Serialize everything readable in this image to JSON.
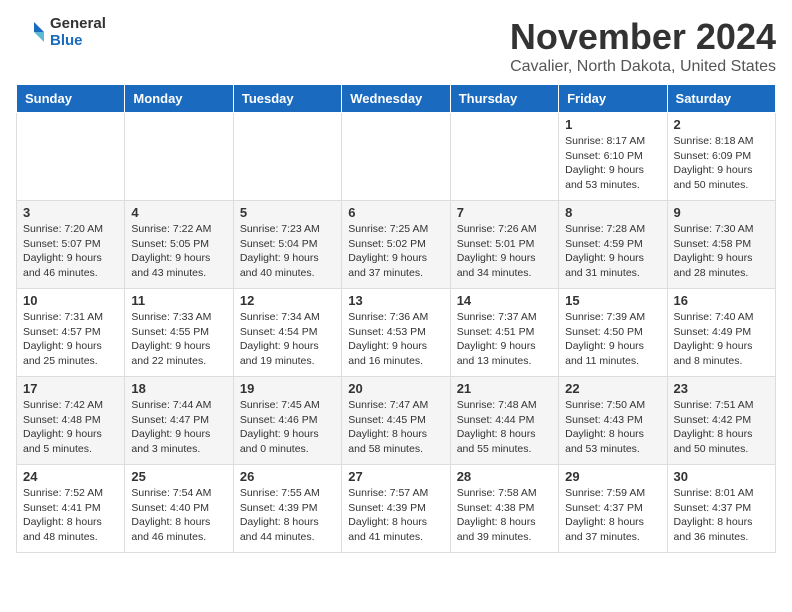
{
  "logo": {
    "general": "General",
    "blue": "Blue"
  },
  "header": {
    "month": "November 2024",
    "location": "Cavalier, North Dakota, United States"
  },
  "weekdays": [
    "Sunday",
    "Monday",
    "Tuesday",
    "Wednesday",
    "Thursday",
    "Friday",
    "Saturday"
  ],
  "weeks": [
    [
      {
        "day": "",
        "info": ""
      },
      {
        "day": "",
        "info": ""
      },
      {
        "day": "",
        "info": ""
      },
      {
        "day": "",
        "info": ""
      },
      {
        "day": "",
        "info": ""
      },
      {
        "day": "1",
        "info": "Sunrise: 8:17 AM\nSunset: 6:10 PM\nDaylight: 9 hours and 53 minutes."
      },
      {
        "day": "2",
        "info": "Sunrise: 8:18 AM\nSunset: 6:09 PM\nDaylight: 9 hours and 50 minutes."
      }
    ],
    [
      {
        "day": "3",
        "info": "Sunrise: 7:20 AM\nSunset: 5:07 PM\nDaylight: 9 hours and 46 minutes."
      },
      {
        "day": "4",
        "info": "Sunrise: 7:22 AM\nSunset: 5:05 PM\nDaylight: 9 hours and 43 minutes."
      },
      {
        "day": "5",
        "info": "Sunrise: 7:23 AM\nSunset: 5:04 PM\nDaylight: 9 hours and 40 minutes."
      },
      {
        "day": "6",
        "info": "Sunrise: 7:25 AM\nSunset: 5:02 PM\nDaylight: 9 hours and 37 minutes."
      },
      {
        "day": "7",
        "info": "Sunrise: 7:26 AM\nSunset: 5:01 PM\nDaylight: 9 hours and 34 minutes."
      },
      {
        "day": "8",
        "info": "Sunrise: 7:28 AM\nSunset: 4:59 PM\nDaylight: 9 hours and 31 minutes."
      },
      {
        "day": "9",
        "info": "Sunrise: 7:30 AM\nSunset: 4:58 PM\nDaylight: 9 hours and 28 minutes."
      }
    ],
    [
      {
        "day": "10",
        "info": "Sunrise: 7:31 AM\nSunset: 4:57 PM\nDaylight: 9 hours and 25 minutes."
      },
      {
        "day": "11",
        "info": "Sunrise: 7:33 AM\nSunset: 4:55 PM\nDaylight: 9 hours and 22 minutes."
      },
      {
        "day": "12",
        "info": "Sunrise: 7:34 AM\nSunset: 4:54 PM\nDaylight: 9 hours and 19 minutes."
      },
      {
        "day": "13",
        "info": "Sunrise: 7:36 AM\nSunset: 4:53 PM\nDaylight: 9 hours and 16 minutes."
      },
      {
        "day": "14",
        "info": "Sunrise: 7:37 AM\nSunset: 4:51 PM\nDaylight: 9 hours and 13 minutes."
      },
      {
        "day": "15",
        "info": "Sunrise: 7:39 AM\nSunset: 4:50 PM\nDaylight: 9 hours and 11 minutes."
      },
      {
        "day": "16",
        "info": "Sunrise: 7:40 AM\nSunset: 4:49 PM\nDaylight: 9 hours and 8 minutes."
      }
    ],
    [
      {
        "day": "17",
        "info": "Sunrise: 7:42 AM\nSunset: 4:48 PM\nDaylight: 9 hours and 5 minutes."
      },
      {
        "day": "18",
        "info": "Sunrise: 7:44 AM\nSunset: 4:47 PM\nDaylight: 9 hours and 3 minutes."
      },
      {
        "day": "19",
        "info": "Sunrise: 7:45 AM\nSunset: 4:46 PM\nDaylight: 9 hours and 0 minutes."
      },
      {
        "day": "20",
        "info": "Sunrise: 7:47 AM\nSunset: 4:45 PM\nDaylight: 8 hours and 58 minutes."
      },
      {
        "day": "21",
        "info": "Sunrise: 7:48 AM\nSunset: 4:44 PM\nDaylight: 8 hours and 55 minutes."
      },
      {
        "day": "22",
        "info": "Sunrise: 7:50 AM\nSunset: 4:43 PM\nDaylight: 8 hours and 53 minutes."
      },
      {
        "day": "23",
        "info": "Sunrise: 7:51 AM\nSunset: 4:42 PM\nDaylight: 8 hours and 50 minutes."
      }
    ],
    [
      {
        "day": "24",
        "info": "Sunrise: 7:52 AM\nSunset: 4:41 PM\nDaylight: 8 hours and 48 minutes."
      },
      {
        "day": "25",
        "info": "Sunrise: 7:54 AM\nSunset: 4:40 PM\nDaylight: 8 hours and 46 minutes."
      },
      {
        "day": "26",
        "info": "Sunrise: 7:55 AM\nSunset: 4:39 PM\nDaylight: 8 hours and 44 minutes."
      },
      {
        "day": "27",
        "info": "Sunrise: 7:57 AM\nSunset: 4:39 PM\nDaylight: 8 hours and 41 minutes."
      },
      {
        "day": "28",
        "info": "Sunrise: 7:58 AM\nSunset: 4:38 PM\nDaylight: 8 hours and 39 minutes."
      },
      {
        "day": "29",
        "info": "Sunrise: 7:59 AM\nSunset: 4:37 PM\nDaylight: 8 hours and 37 minutes."
      },
      {
        "day": "30",
        "info": "Sunrise: 8:01 AM\nSunset: 4:37 PM\nDaylight: 8 hours and 36 minutes."
      }
    ]
  ]
}
